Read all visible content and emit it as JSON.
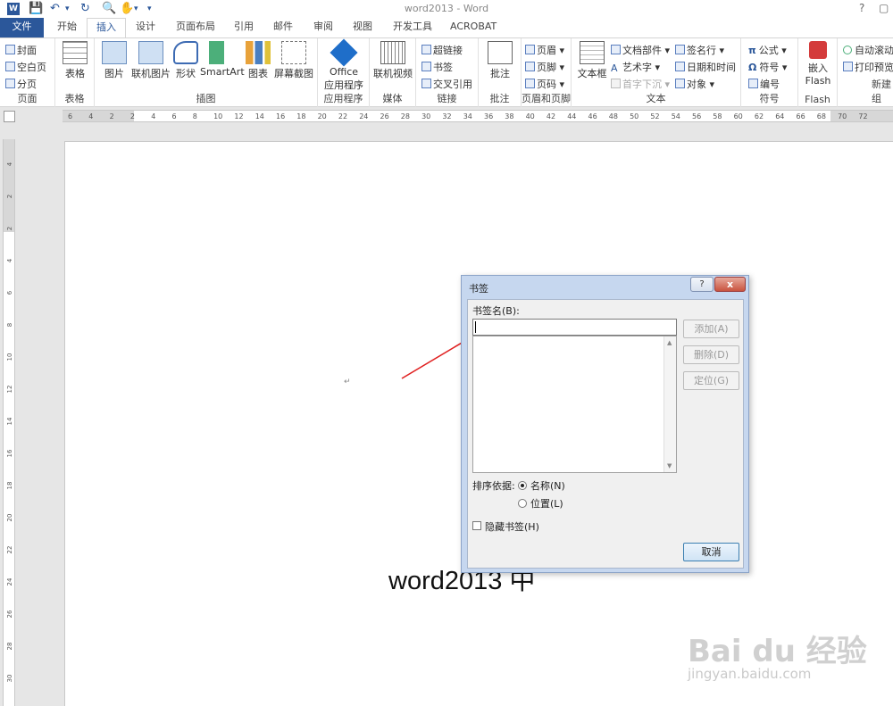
{
  "window": {
    "title": "word2013 - Word",
    "help": "?"
  },
  "tabs": [
    {
      "label": "文件"
    },
    {
      "label": "开始"
    },
    {
      "label": "插入"
    },
    {
      "label": "设计"
    },
    {
      "label": "页面布局"
    },
    {
      "label": "引用"
    },
    {
      "label": "邮件"
    },
    {
      "label": "审阅"
    },
    {
      "label": "视图"
    },
    {
      "label": "开发工具"
    },
    {
      "label": "ACROBAT"
    }
  ],
  "ribbon": {
    "pages": {
      "label": "页面",
      "cover": "封面",
      "blank": "空白页",
      "break": "分页"
    },
    "tables": {
      "label": "表格",
      "table": "表格"
    },
    "illustrations": {
      "label": "插图",
      "picture": "图片",
      "online_picture": "联机图片",
      "shapes": "形状",
      "smartart": "SmartArt",
      "chart": "图表",
      "screenshot": "屏幕截图"
    },
    "apps": {
      "label": "应用程序",
      "office1": "Office",
      "office2": "应用程序"
    },
    "media": {
      "label": "媒体",
      "online_video": "联机视频"
    },
    "links": {
      "label": "链接",
      "hyperlink": "超链接",
      "bookmark": "书签",
      "crossref": "交叉引用"
    },
    "comments": {
      "label": "批注",
      "comment": "批注"
    },
    "header_footer": {
      "label": "页眉和页脚",
      "header": "页眉",
      "footer": "页脚",
      "page_number": "页码"
    },
    "text": {
      "label": "文本",
      "textbox": "文本框",
      "quick_parts": "文档部件",
      "wordart": "艺术字",
      "dropcap": "首字下沉",
      "signature": "签名行",
      "datetime": "日期和时间",
      "object": "对象"
    },
    "symbols": {
      "label": "符号",
      "equation": "公式",
      "symbol": "符号",
      "numbering": "编号"
    },
    "flash": {
      "label": "Flash",
      "embed1": "嵌入",
      "embed2": "Flash"
    },
    "new_group": {
      "label": "新建组",
      "autoscroll": "自动滚动",
      "print_preview": "打印预览"
    }
  },
  "ruler": {
    "h_ticks": [
      "6",
      "4",
      "2",
      "2",
      "4",
      "6",
      "8",
      "10",
      "12",
      "14",
      "16",
      "18",
      "20",
      "22",
      "24",
      "26",
      "28",
      "30",
      "32",
      "34",
      "36",
      "38",
      "40",
      "42",
      "44",
      "46",
      "48",
      "50",
      "52",
      "54",
      "56",
      "58",
      "60",
      "62",
      "64",
      "66",
      "68",
      "70",
      "72"
    ],
    "v_ticks": [
      "4",
      "2",
      "2",
      "4",
      "6",
      "8",
      "10",
      "12",
      "14",
      "16",
      "18",
      "20",
      "22",
      "24",
      "26",
      "28",
      "30"
    ]
  },
  "document": {
    "paragraph_mark": "↵",
    "text": "word2013 中"
  },
  "dialog": {
    "title": "书签",
    "help_label": "?",
    "close_label": "x",
    "name_label": "书签名(B):",
    "name_value": "",
    "add_label": "添加(A)",
    "delete_label": "删除(D)",
    "goto_label": "定位(G)",
    "sort_label": "排序依据:",
    "sort_name": "名称(N)",
    "sort_location": "位置(L)",
    "hidden_label": "隐藏书签(H)",
    "cancel_label": "取消"
  },
  "watermark": {
    "main": "Bai du 经验",
    "sub": "jingyan.baidu.com"
  }
}
